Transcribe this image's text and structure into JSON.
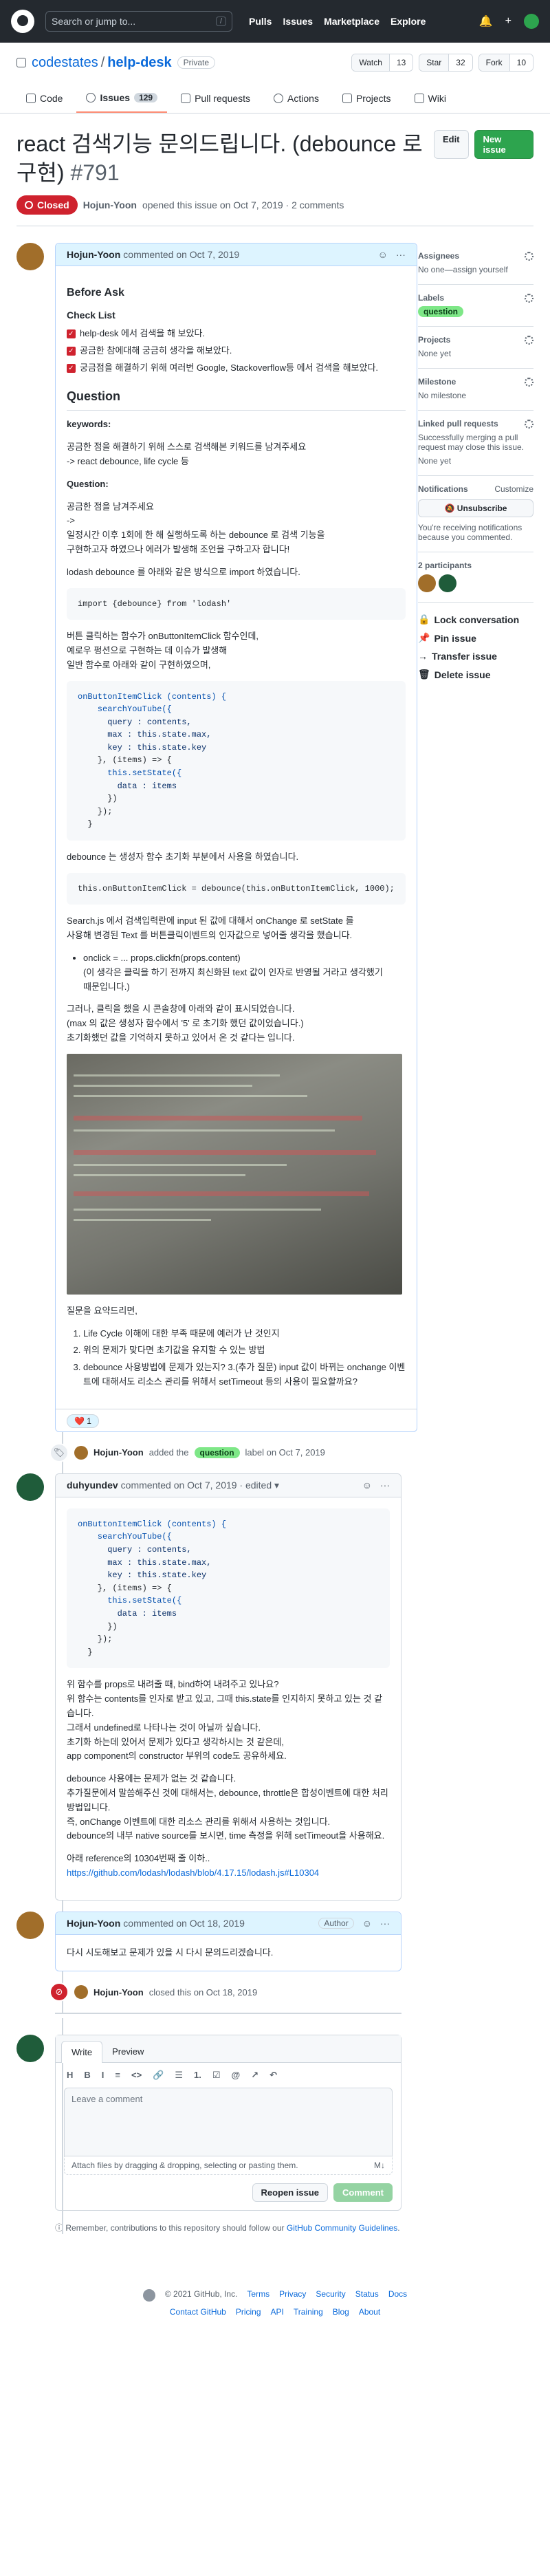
{
  "header": {
    "search_placeholder": "Search or jump to...",
    "search_shortcut": "/",
    "nav": [
      "Pulls",
      "Issues",
      "Marketplace",
      "Explore"
    ],
    "plus_icon": "+"
  },
  "repo": {
    "owner": "codestates",
    "name": "help-desk",
    "visibility": "Private",
    "watch_label": "Watch",
    "watch_count": "13",
    "star_label": "Star",
    "star_count": "32",
    "fork_label": "Fork",
    "fork_count": "10",
    "tabs": [
      {
        "label": "Code",
        "icon": "code-icon"
      },
      {
        "label": "Issues",
        "count": "129",
        "icon": "issue-icon"
      },
      {
        "label": "Pull requests",
        "icon": "pull-request-icon"
      },
      {
        "label": "Actions",
        "icon": "play-icon"
      },
      {
        "label": "Projects",
        "icon": "table-icon"
      },
      {
        "label": "Wiki",
        "icon": "book-icon"
      }
    ]
  },
  "issue": {
    "title": "react 검색기능 문의드립니다. (debounce 로 구현)",
    "number": "#791",
    "edit_label": "Edit",
    "new_issue_label": "New issue",
    "state": "Closed",
    "author": "Hojun-Yoon",
    "opened_text": "opened this issue on Oct 7, 2019 · 2 comments"
  },
  "first_comment": {
    "author": "Hojun-Yoon",
    "time": "commented on Oct 7, 2019",
    "h_before_ask": "Before Ask",
    "h_checklist": "Check List",
    "checklist": [
      "help-desk 에서 검색을 해 보았다.",
      "공금한 참에대해 궁금히 생각을 해보았다.",
      "궁금점을 해결하기 위해 여러번 Google, Stackoverflow등 에서 검색을 해보았다."
    ],
    "h_question": "Question",
    "keywords_label": "keywords:",
    "keywords_line1": "공금한 점을 해결하기 위해 스스로 검색해본 키워드를 남겨주세요",
    "keywords_line2": "-> react debounce, life cycle 등",
    "question_label": "Question:",
    "question_line1": "공금한 점을 남겨주세요",
    "question_line2": "->",
    "question_line3": "일정시간 이후 1회에 한 해 실행하도록 하는 debounce 로 검색 기능을",
    "question_line4": "구현하고자 하였으나 에러가 발생해 조언을 구하고자 합니다!",
    "lodash_text": "lodash debounce 를 아래와 같은 방식으로 import 하였습니다.",
    "import_code": "import {debounce} from 'lodash'",
    "onclick_text1": "버튼 클릭하는 함수가 onButtonItemClick 함수인데,",
    "onclick_text2": "예로우 펑션으로 구현하는 데 이슈가 발생해",
    "onclick_text3": "일반 함수로 아래와 같이 구현하였으며,",
    "code1_line1": "onButtonItemClick (contents) {",
    "code1_line2": "    searchYouTube({",
    "code1_line3": "      query : contents,",
    "code1_line4": "      max : this.state.max,",
    "code1_line5": "      key : this.state.key",
    "code1_line6": "    }, (items) => {",
    "code1_line7": "      this.setState({",
    "code1_line8": "        data : items",
    "code1_line9": "      })",
    "code1_line10": "    });",
    "code1_line11": "  }",
    "debounce_text": "debounce 는 생성자 함수 초기화 부분에서 사용을 하였습니다.",
    "code2": "this.onButtonItemClick = debounce(this.onButtonItemClick, 1000);",
    "search_text1": "Search.js 에서 검색입력란에 input 된 값에 대해서 onChange 로 setState 를",
    "search_text2": "사용해 변경된 Text 를 버튼클릭이벤트의 인자값으로 넣어줄 생각을 했습니다.",
    "bullet1": "onclick = ... props.clickfn(props.content)",
    "bullet2": "(이 생각은 클릭을 하기 전까지 최신화된 text 값이 인자로 반영될 거라고 생각했기",
    "bullet3": "때문입니다.)",
    "error_text1": "그러나, 클릭을 했을 시 콘솔창에 아래와 같이 표시되었습니다.",
    "error_text2": "(max 의 값은 생성자 함수에서 '5' 로 초기화 했던 값이었습니다.)",
    "error_text3": "초기화했던 값을 기억하지 못하고 있어서 온 것 같다는 입니다.",
    "summary_label": "질문을 요약드리면,",
    "summary": [
      "Life Cycle 이해에 대한 부족 때문에 예러가 난 것인지",
      "위의 문제가 맞다면 초기값을 유지할 수 있는 방법",
      "debounce 사용방법에 문제가 있는지? 3.(추가 질문) input 값이 바뀌는 onchange 이벤트에 대해서도 리소스 관리를 위해서 setTimeout 등의 사용이 필요할까요?"
    ],
    "reaction": "❤️ 1"
  },
  "label_event": {
    "actor": "Hojun-Yoon",
    "action": "added the",
    "label": "question",
    "suffix": "label on Oct 7, 2019"
  },
  "second_comment": {
    "author": "duhyundev",
    "time": "commented on Oct 7, 2019 · edited ▾",
    "code_line1": "onButtonItemClick (contents) {",
    "code_line2": "    searchYouTube({",
    "code_line3": "      query : contents,",
    "code_line4": "      max : this.state.max,",
    "code_line5": "      key : this.state.key",
    "code_line6": "    }, (items) => {",
    "code_line7": "      this.setState({",
    "code_line8": "        data : items",
    "code_line9": "      })",
    "code_line10": "    });",
    "code_line11": "  }",
    "p1_line1": "위 함수를 props로 내려줄 때, bind하여 내려주고 있나요?",
    "p1_line2": "위 함수는 contents를 인자로 받고 있고, 그때 this.state를 인지하지 못하고 있는 것 같습니다.",
    "p1_line3": "그래서 undefined로 나타나는 것이 아닐까 싶습니다.",
    "p1_line4": "초기화 하는데 있어서 문제가 있다고 생각하시는 것 같은데,",
    "p1_line5": "app component의 constructor 부위의 code도 공유하세요.",
    "p2_line1": "debounce 사용에는 문제가 없는 것 같습니다.",
    "p2_line2": "추가질문에서 말씀해주신 것에 대해서는, debounce, throttle은 합성이벤트에 대한 처리 방법입니다.",
    "p2_line3": "즉, onChange 이벤트에 대한 리소스 관리를 위해서 사용하는 것입니다.",
    "p2_line4": "debounce의 내부 native source를 보시면, time 측정을 위해 setTimeout을 사용해요.",
    "ref_text": "아래 reference의 10304번째 줄 이하..",
    "ref_link": "https://github.com/lodash/lodash/blob/4.17.15/lodash.js#L10304"
  },
  "third_comment": {
    "author": "Hojun-Yoon",
    "time": "commented on Oct 18, 2019",
    "badge": "Author",
    "body": "다시 시도해보고 문제가 있을 시 다시 문의드리겠습니다."
  },
  "close_event": {
    "actor": "Hojun-Yoon",
    "text": "closed this on Oct 18, 2019"
  },
  "editor": {
    "tab_write": "Write",
    "tab_preview": "Preview",
    "toolbar": [
      "H",
      "B",
      "I",
      "≡",
      "<>",
      "🔗",
      "☰",
      "1.",
      "☑",
      "@",
      "↗",
      "↶"
    ],
    "placeholder": "Leave a comment",
    "attach_text": "Attach files by dragging & dropping, selecting or pasting them.",
    "md_icon": "M↓",
    "reopen_label": "Reopen issue",
    "comment_label": "Comment",
    "remember_text": "Remember, contributions to this repository should follow our",
    "remember_link": "GitHub Community Guidelines",
    "remember_end": "."
  },
  "sidebar": {
    "assignees_title": "Assignees",
    "assignees_value": "No one—assign yourself",
    "labels_title": "Labels",
    "labels_value": "question",
    "projects_title": "Projects",
    "projects_value": "None yet",
    "milestone_title": "Milestone",
    "milestone_value": "No milestone",
    "linked_title": "Linked pull requests",
    "linked_value1": "Successfully merging a pull request may close this issue.",
    "linked_value2": "None yet",
    "notifications_title": "Notifications",
    "notifications_customize": "Customize",
    "unsubscribe_label": "Unsubscribe",
    "notifications_note": "You're receiving notifications because you commented.",
    "participants_title": "2 participants",
    "lock_label": "Lock conversation",
    "pin_label": "Pin issue",
    "transfer_label": "Transfer issue",
    "delete_label": "Delete issue"
  },
  "footer": {
    "copyright": "© 2021 GitHub, Inc.",
    "row1": [
      "Terms",
      "Privacy",
      "Security",
      "Status",
      "Docs"
    ],
    "row2": [
      "Contact GitHub",
      "Pricing",
      "API",
      "Training",
      "Blog",
      "About"
    ]
  }
}
